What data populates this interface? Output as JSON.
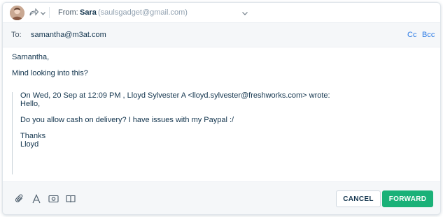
{
  "from_row": {
    "label": "From:",
    "name": "Sara",
    "email": "(saulsgadget@gmail.com)"
  },
  "to_row": {
    "label": "To:",
    "value": "samantha@m3at.com",
    "cc_label": "Cc",
    "bcc_label": "Bcc"
  },
  "message": {
    "greeting": "Samantha,",
    "line1": "Mind looking into this?"
  },
  "quoted": {
    "header": "On Wed, 20 Sep at 12:09 PM , Lloyd Sylvester A <lloyd.sylvester@freshworks.com> wrote:",
    "lines": [
      "Hello,",
      "Do you allow cash on delivery? I have issues with my Paypal :/",
      "Thanks",
      "Lloyd"
    ]
  },
  "footer": {
    "icons": [
      "paperclip-icon",
      "text-format-icon",
      "image-icon",
      "book-icon"
    ],
    "cancel_label": "CANCEL",
    "forward_label": "FORWARD"
  },
  "colors": {
    "accent_blue": "#2c7be5",
    "forward_green": "#1ab178",
    "text": "#12344d",
    "muted": "#92a2b1"
  }
}
